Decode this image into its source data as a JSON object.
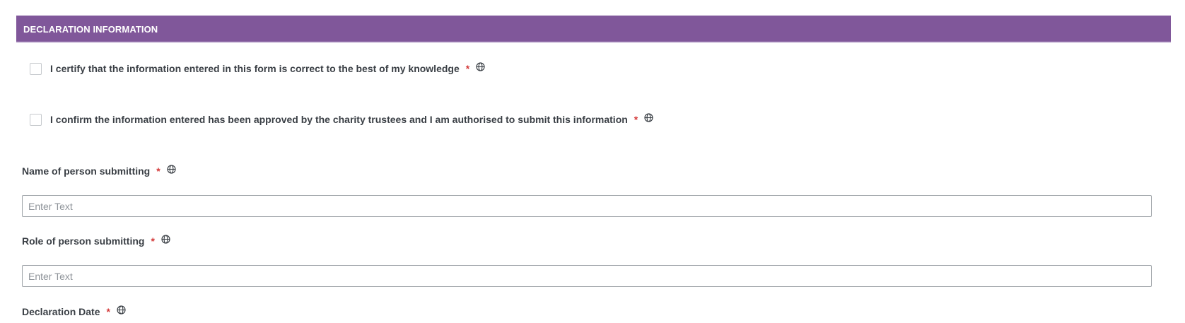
{
  "section": {
    "title": "DECLARATION INFORMATION"
  },
  "colors": {
    "header_bg": "#80579a",
    "required": "#d43a3a"
  },
  "declarations": [
    {
      "label": "I certify that the information entered in this form is correct to the best of my knowledge",
      "required_mark": "*",
      "checked": false,
      "icon": "globe-icon"
    },
    {
      "label": "I confirm the information entered has been approved by the charity trustees and I am authorised to submit this information",
      "required_mark": "*",
      "checked": false,
      "icon": "globe-icon"
    }
  ],
  "fields": {
    "name": {
      "label": "Name of person submitting",
      "required_mark": "*",
      "placeholder": "Enter Text",
      "value": "",
      "icon": "globe-icon"
    },
    "role": {
      "label": "Role of person submitting",
      "required_mark": "*",
      "placeholder": "Enter Text",
      "value": "",
      "icon": "globe-icon"
    },
    "date": {
      "label": "Declaration Date",
      "required_mark": "*",
      "icon": "globe-icon"
    }
  }
}
